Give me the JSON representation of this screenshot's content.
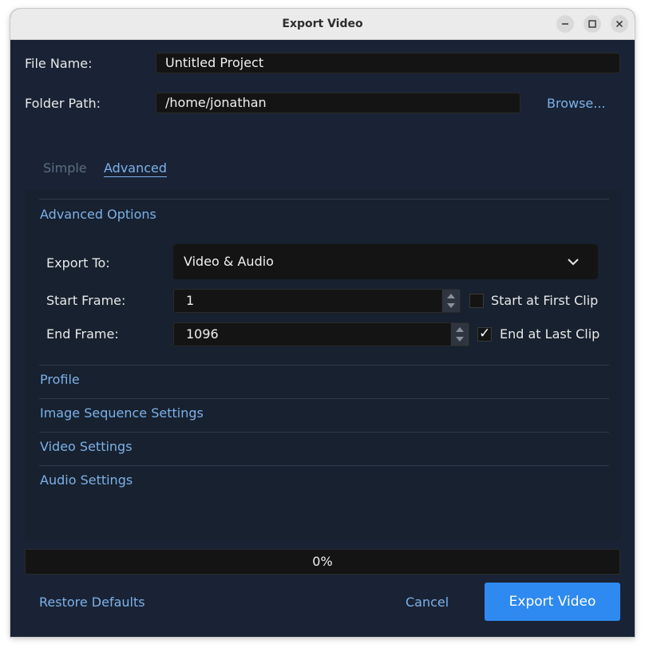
{
  "window": {
    "title": "Export Video"
  },
  "form": {
    "file_name_label": "File Name:",
    "file_name_value": "Untitled Project",
    "folder_path_label": "Folder Path:",
    "folder_path_value": "/home/jonathan",
    "browse_label": "Browse..."
  },
  "tabs": [
    {
      "label": "Simple",
      "active": false
    },
    {
      "label": "Advanced",
      "active": true
    }
  ],
  "advanced": {
    "section_title": "Advanced Options",
    "export_to_label": "Export To:",
    "export_to_value": "Video & Audio",
    "start_frame_label": "Start Frame:",
    "start_frame_value": "1",
    "start_at_first_clip_label": "Start at First Clip",
    "start_at_first_clip_checked": false,
    "end_frame_label": "End Frame:",
    "end_frame_value": "1096",
    "end_at_last_clip_label": "End at Last Clip",
    "end_at_last_clip_checked": true,
    "check_glyph": "✓"
  },
  "sections": [
    {
      "label": "Profile"
    },
    {
      "label": "Image Sequence Settings"
    },
    {
      "label": "Video Settings"
    },
    {
      "label": "Audio Settings"
    }
  ],
  "progress": {
    "text": "0%",
    "fraction": 0
  },
  "footer": {
    "restore_defaults_label": "Restore Defaults",
    "cancel_label": "Cancel",
    "export_label": "Export Video"
  },
  "colors": {
    "window_bg": "#192335",
    "panel_bg": "#17212f",
    "field_bg": "#141414",
    "link": "#7eb0e8",
    "accent": "#2e8af0"
  },
  "icons": [
    "minimize-icon",
    "maximize-icon",
    "close-icon",
    "chevron-down-icon",
    "spin-up-icon",
    "spin-down-icon",
    "checkmark-icon"
  ]
}
